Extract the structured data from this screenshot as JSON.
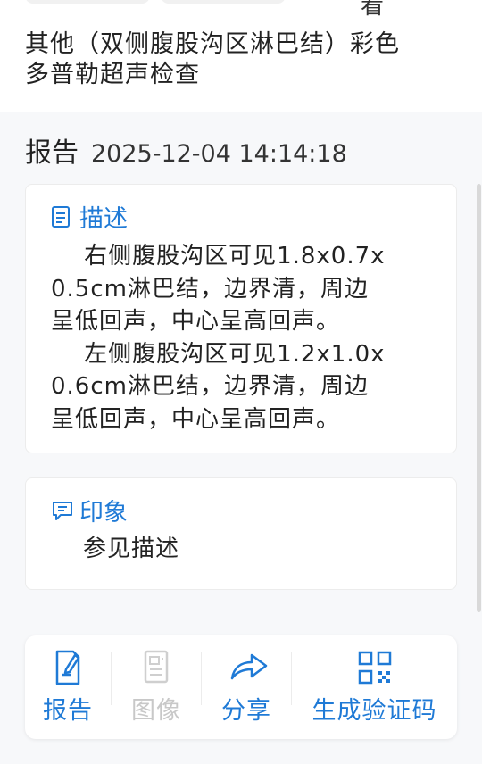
{
  "header": {
    "top_cut_text": "看",
    "exam_title_line1": "其他（双侧腹股沟区淋巴结）彩色",
    "exam_title_line2": "多普勒超声检查"
  },
  "report": {
    "label": "报告",
    "datetime": "2025-12-04 14:14:18"
  },
  "description": {
    "title": "描述",
    "text": "    右侧腹股沟区可见1.8x0.7x\n0.5cm淋巴结，边界清，周边\n呈低回声，中心呈高回声。\n    左侧腹股沟区可见1.2x1.0x\n0.6cm淋巴结，边界清，周边\n呈低回声，中心呈高回声。"
  },
  "impression": {
    "title": "印象",
    "text": "参见描述"
  },
  "bottom_bar": {
    "report_label": "报告",
    "image_label": "图像",
    "share_label": "分享",
    "code_label": "生成验证码"
  },
  "colors": {
    "accent": "#1f7ad6",
    "disabled": "#c8c8c8",
    "background": "#f7f8fa"
  }
}
